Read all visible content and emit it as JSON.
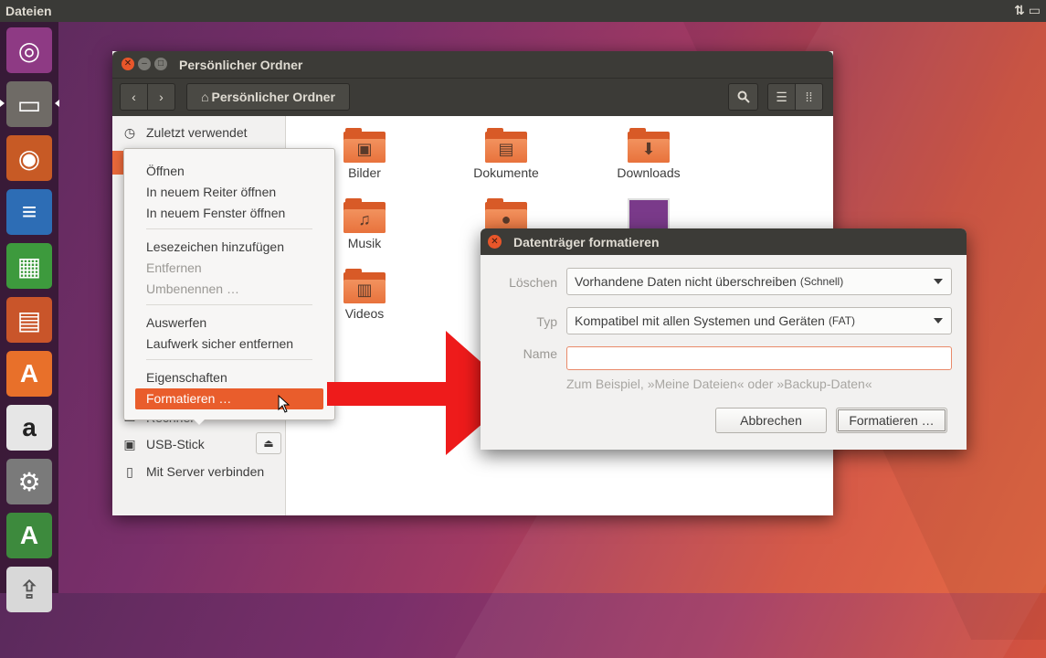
{
  "top_panel": {
    "title": "Dateien",
    "tray_icon": "network-transfer-icon"
  },
  "launcher": {
    "items": [
      {
        "name": "ubuntu-dash",
        "glyph": "◎",
        "color": "#9b3e8f"
      },
      {
        "name": "files",
        "glyph": "▭",
        "color": "#8a8580"
      },
      {
        "name": "firefox",
        "glyph": "◉",
        "color": "#e8702a"
      },
      {
        "name": "writer",
        "glyph": "≡",
        "color": "#2d6db5"
      },
      {
        "name": "calc",
        "glyph": "▦",
        "color": "#3d9a3d"
      },
      {
        "name": "impress",
        "glyph": "▤",
        "color": "#c9552a"
      },
      {
        "name": "software-center",
        "glyph": "A",
        "color": "#e8702a"
      },
      {
        "name": "amazon",
        "glyph": "a",
        "color": "#e0e0e0"
      },
      {
        "name": "system-settings",
        "glyph": "⚙",
        "color": "#c0392b"
      },
      {
        "name": "software-updater",
        "glyph": "A",
        "color": "#3d8a3d"
      },
      {
        "name": "usb",
        "glyph": "⇪",
        "color": "#dcdcdc"
      }
    ]
  },
  "files_window": {
    "title": "Persönlicher Ordner",
    "path_button": "Persönlicher Ordner",
    "sidebar": {
      "items": [
        {
          "label": "Zuletzt verwendet",
          "icon": "clock-icon"
        },
        {
          "label": "USB-Stick",
          "icon": "usb-drive-icon"
        },
        {
          "label": "Mit Server verbinden",
          "icon": "server-icon"
        }
      ],
      "partial_label": "Rechner"
    },
    "folders": [
      {
        "label": "Bilder",
        "emblem": "picture-icon",
        "glyph": "▣"
      },
      {
        "label": "Dokumente",
        "emblem": "document-icon",
        "glyph": "▤"
      },
      {
        "label": "Downloads",
        "emblem": "download-icon",
        "glyph": "⬇"
      },
      {
        "label": "Musik",
        "emblem": "music-icon",
        "glyph": "♫"
      },
      {
        "label": "Videos",
        "emblem": "film-icon",
        "glyph": "▥"
      }
    ]
  },
  "context_menu": {
    "group1": [
      "Öffnen",
      "In neuem Reiter öffnen",
      "In neuem Fenster öffnen"
    ],
    "group2": [
      "Lesezeichen hinzufügen",
      "Entfernen",
      "Umbenennen …"
    ],
    "group3": [
      "Auswerfen",
      "Laufwerk sicher entfernen"
    ],
    "group4": [
      "Eigenschaften",
      "Formatieren …"
    ]
  },
  "dialog": {
    "title": "Datenträger formatieren",
    "erase_label": "Löschen",
    "erase_value": "Vorhandene Daten nicht überschreiben",
    "erase_value_small": "(Schnell)",
    "type_label": "Typ",
    "type_value": "Kompatibel mit allen Systemen und Geräten",
    "type_value_small": "(FAT)",
    "name_label": "Name",
    "name_value": "",
    "hint": "Zum Beispiel, »Meine Dateien« oder »Backup-Daten«",
    "cancel_label": "Abbrechen",
    "format_label": "Formatieren …"
  }
}
